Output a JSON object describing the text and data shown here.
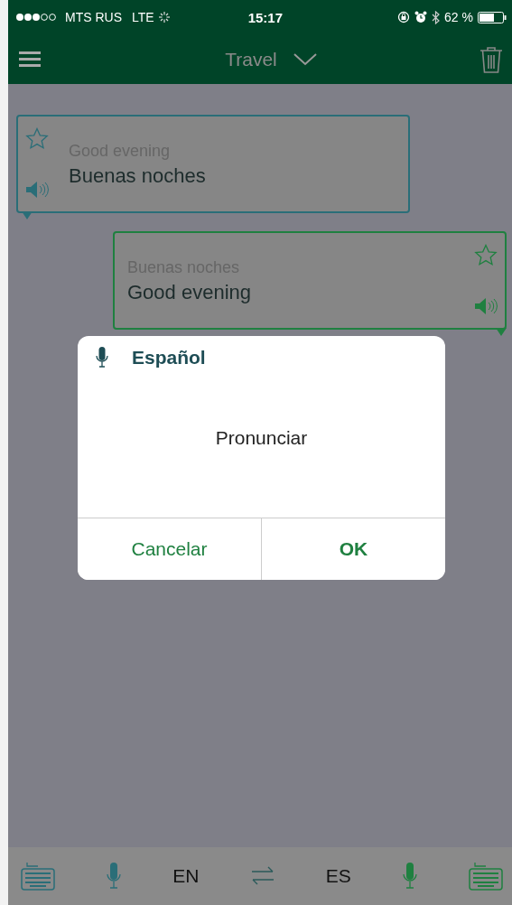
{
  "status_bar": {
    "carrier": "MTS RUS",
    "network": "LTE",
    "time": "15:17",
    "battery": "62 %"
  },
  "header": {
    "title": "Travel"
  },
  "messages": [
    {
      "kind": "incoming",
      "source": "Good evening",
      "translation": "Buenas noches"
    },
    {
      "kind": "outgoing",
      "source": "Buenas noches",
      "translation": "Good evening"
    }
  ],
  "dialog": {
    "language": "Español",
    "message": "Pronunciar",
    "buttons": [
      {
        "label": "Cancelar",
        "kind": "cancel"
      },
      {
        "label": "OK",
        "kind": "confirm"
      }
    ]
  },
  "bottom_bar": {
    "source_language": "EN",
    "target_language": "ES"
  }
}
